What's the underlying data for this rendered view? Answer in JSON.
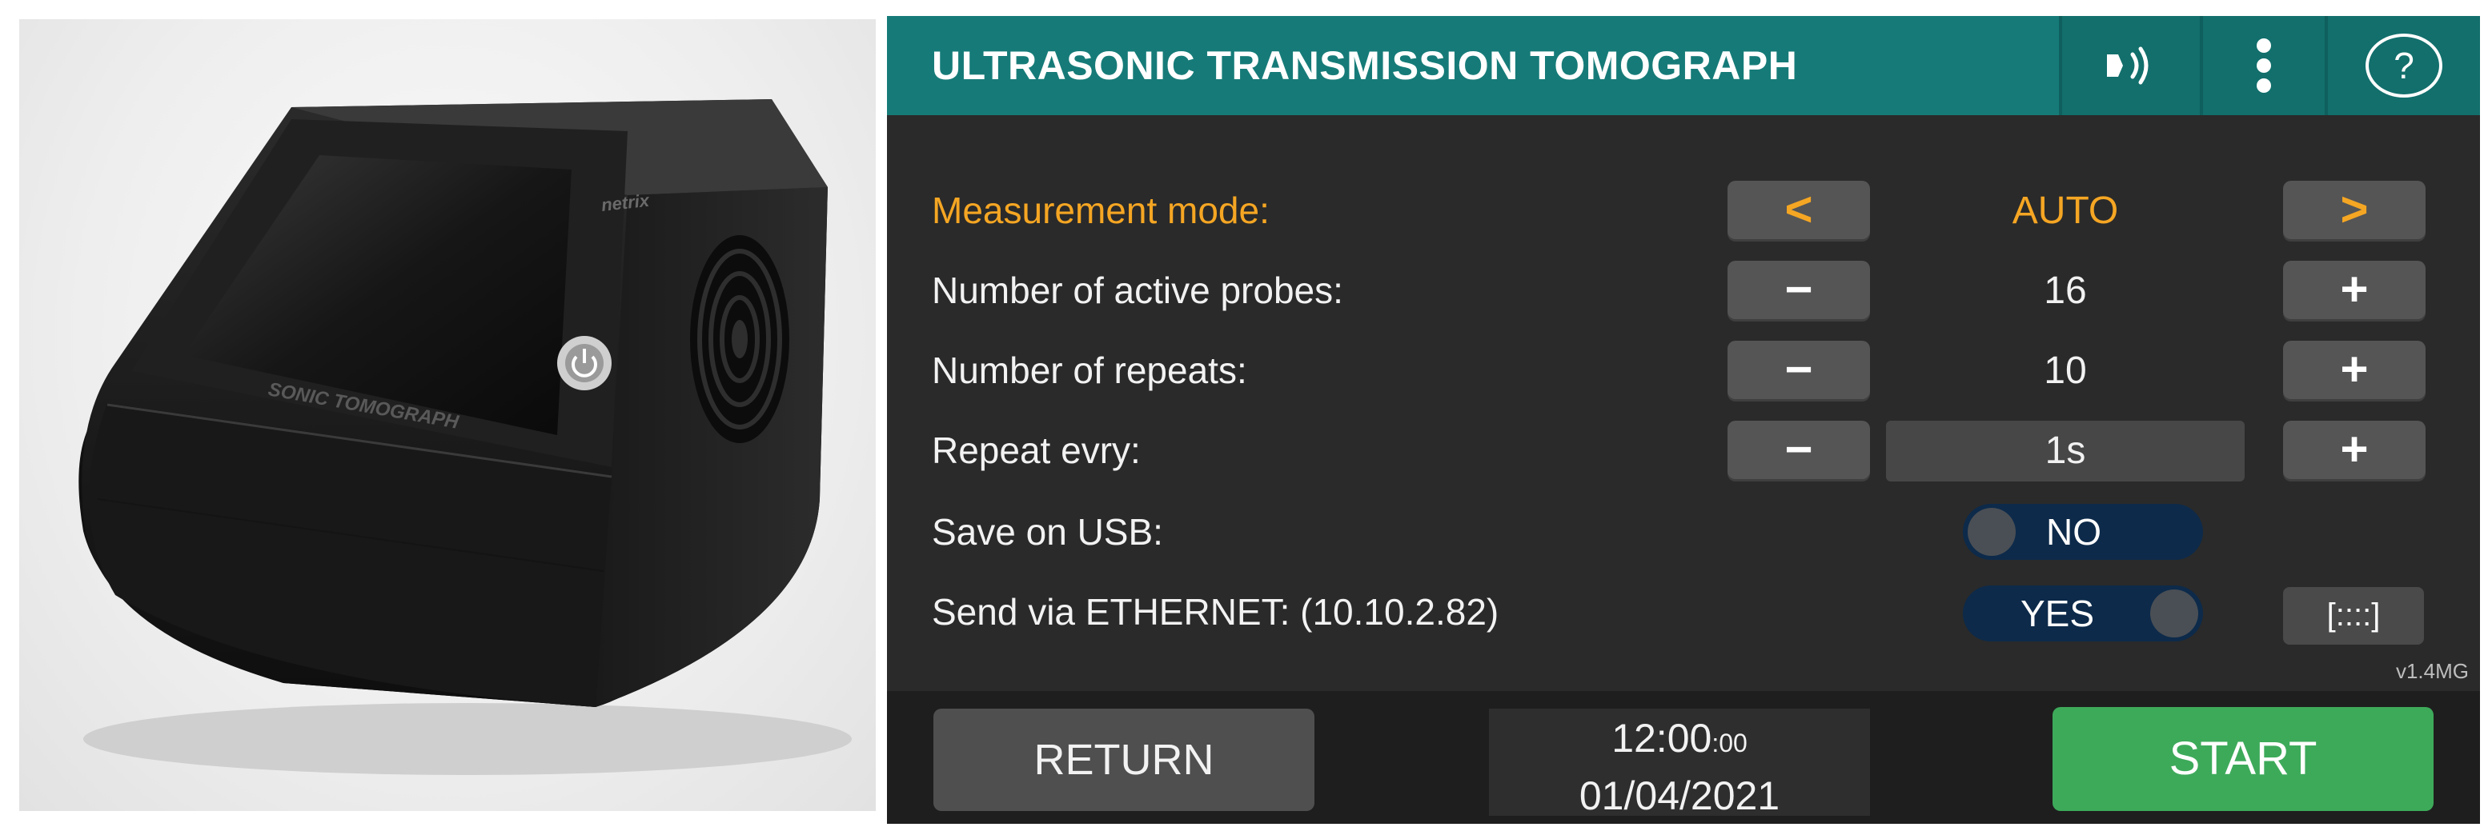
{
  "device_photo": {
    "screen_text": "SONIC TOMOGRAPH",
    "brand_text": "netrix"
  },
  "header": {
    "title": "ULTRASONIC TRANSMISSION TOMOGRAPH",
    "icons": [
      "transmit-icon",
      "more-vertical-icon",
      "help-icon"
    ],
    "help_glyph": "?"
  },
  "settings": {
    "measurement_mode": {
      "label": "Measurement mode:",
      "value": "AUTO",
      "prev": "<",
      "next": ">"
    },
    "active_probes": {
      "label": "Number of active probes:",
      "value": "16",
      "minus": "−",
      "plus": "+"
    },
    "repeats": {
      "label": "Number of repeats:",
      "value": "10",
      "minus": "−",
      "plus": "+"
    },
    "repeat_every": {
      "label": "Repeat evry:",
      "value": "1s",
      "minus": "−",
      "plus": "+"
    },
    "save_usb": {
      "label": "Save on USB:",
      "state": "NO"
    },
    "ethernet": {
      "label": "Send via ETHERNET: (10.10.2.82)",
      "state": "YES",
      "config_button": "[::::]"
    }
  },
  "version": "v1.4MG",
  "footer": {
    "return_label": "RETURN",
    "time": "12:00",
    "seconds": ":00",
    "date": "01/04/2021",
    "start_label": "START"
  },
  "colors": {
    "header_bg": "#167b78",
    "accent": "#f5a623",
    "panel_bg": "#2a2a2a",
    "button_bg": "#555555",
    "start_bg": "#3daa5a",
    "toggle_bg": "#0d2a4a"
  }
}
